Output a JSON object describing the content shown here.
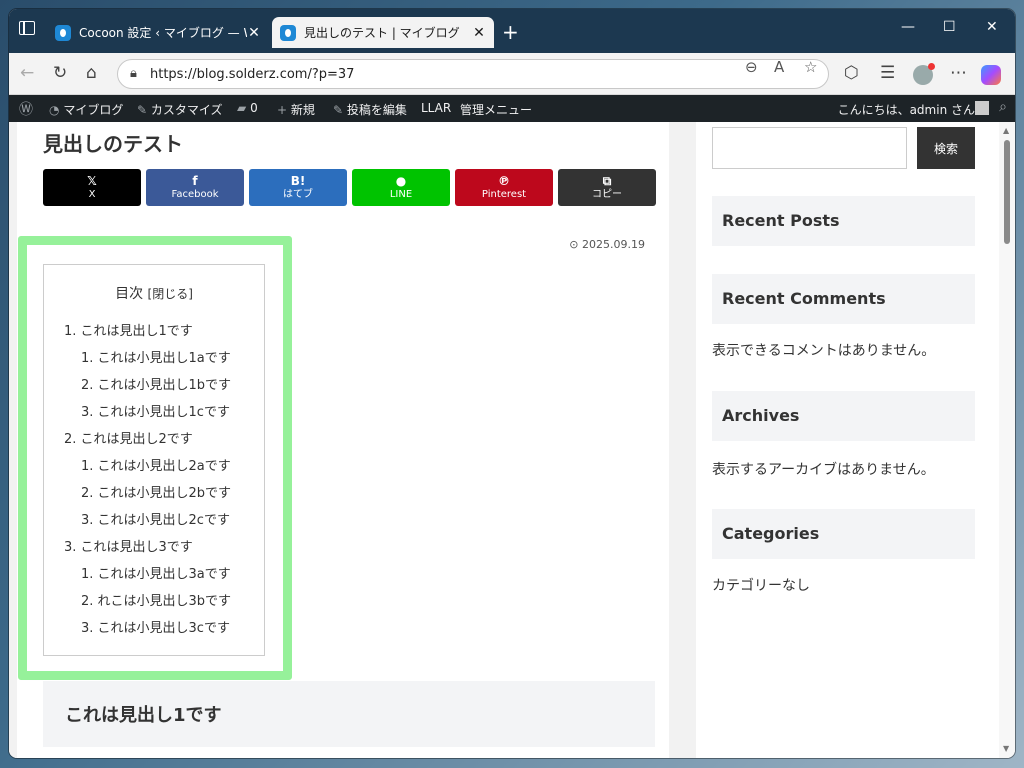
{
  "browser": {
    "tabs": [
      {
        "title": "Cocoon 設定 ‹ マイブログ — WordP",
        "active": false
      },
      {
        "title": "見出しのテスト | マイブログ",
        "active": true
      }
    ],
    "url": "https://blog.solderz.com/?p=37"
  },
  "adminbar": {
    "items": [
      "マイブログ",
      "カスタマイズ",
      "0",
      "新規",
      "投稿を編集",
      "LLAR",
      "管理メニュー"
    ],
    "greeting": "こんにちは、admin さん"
  },
  "post": {
    "title": "見出しのテスト",
    "date": "2025.09.19",
    "share_buttons": [
      {
        "icon": "𝕏",
        "label": "X",
        "color": "#000000"
      },
      {
        "icon": "f",
        "label": "Facebook",
        "color": "#3b5998"
      },
      {
        "icon": "B!",
        "label": "はてブ",
        "color": "#2c6ebd"
      },
      {
        "icon": "●",
        "label": "LINE",
        "color": "#00c300"
      },
      {
        "icon": "℗",
        "label": "Pinterest",
        "color": "#bd081c"
      },
      {
        "icon": "⧉",
        "label": "コピー",
        "color": "#333333"
      }
    ],
    "toc": {
      "title": "目次",
      "toggle": "[閉じる]",
      "items": [
        {
          "label": "1. これは見出し1です",
          "level": 1
        },
        {
          "label": "1. これは小見出し1aです",
          "level": 2
        },
        {
          "label": "2. これは小見出し1bです",
          "level": 2
        },
        {
          "label": "3. これは小見出し1cです",
          "level": 2
        },
        {
          "label": "2. これは見出し2です",
          "level": 1
        },
        {
          "label": "1. これは小見出し2aです",
          "level": 2
        },
        {
          "label": "2. これは小見出し2bです",
          "level": 2
        },
        {
          "label": "3. これは小見出し2cです",
          "level": 2
        },
        {
          "label": "3. これは見出し3です",
          "level": 1
        },
        {
          "label": "1. これは小見出し3aです",
          "level": 2
        },
        {
          "label": "2. れこは小見出し3bです",
          "level": 2
        },
        {
          "label": "3. これは小見出し3cです",
          "level": 2
        }
      ]
    },
    "h2": "これは見出し1です"
  },
  "sidebar": {
    "search_button": "検索",
    "widgets": [
      {
        "title": "Recent Posts",
        "text": ""
      },
      {
        "title": "Recent Comments",
        "text": "表示できるコメントはありません。"
      },
      {
        "title": "Archives",
        "text": "表示するアーカイブはありません。"
      },
      {
        "title": "Categories",
        "text": "カテゴリーなし"
      }
    ]
  },
  "colors": {
    "toc_highlight": "#96f19a",
    "adminbar": "#1d2327"
  }
}
